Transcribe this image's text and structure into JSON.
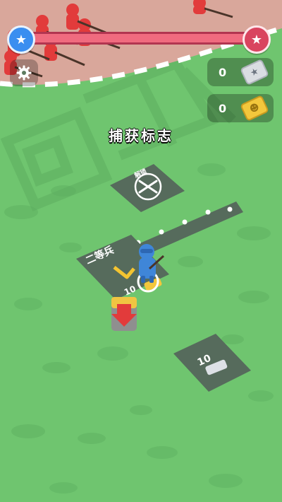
{
  "hud": {
    "progress_fraction": 1.0,
    "resource_silver_count": "0",
    "resource_gold_count": "0"
  },
  "scene": {
    "title": "捕获标志",
    "zone_unlock_label": "解锁",
    "zone_rank_label": "二等兵",
    "zone_rank_price": "10",
    "zone_bottom_price": "10"
  },
  "colors": {
    "grass": "#6fc56f",
    "dirt": "#d9a79b",
    "enemy_red": "#e23b3b",
    "player_blue": "#3f86d8",
    "pad_gray": "#5b7061",
    "bar_red": "#d9445f",
    "shield_blue": "#3a8ef0"
  },
  "icons": {
    "settings": "gear-icon",
    "left_shield": "star-shield-icon",
    "right_shield": "star-shield-icon",
    "silver": "silver-ticket-icon",
    "gold": "gold-ticket-icon",
    "unlock": "crossed-rifles-icon",
    "drop": "down-arrow-icon"
  }
}
